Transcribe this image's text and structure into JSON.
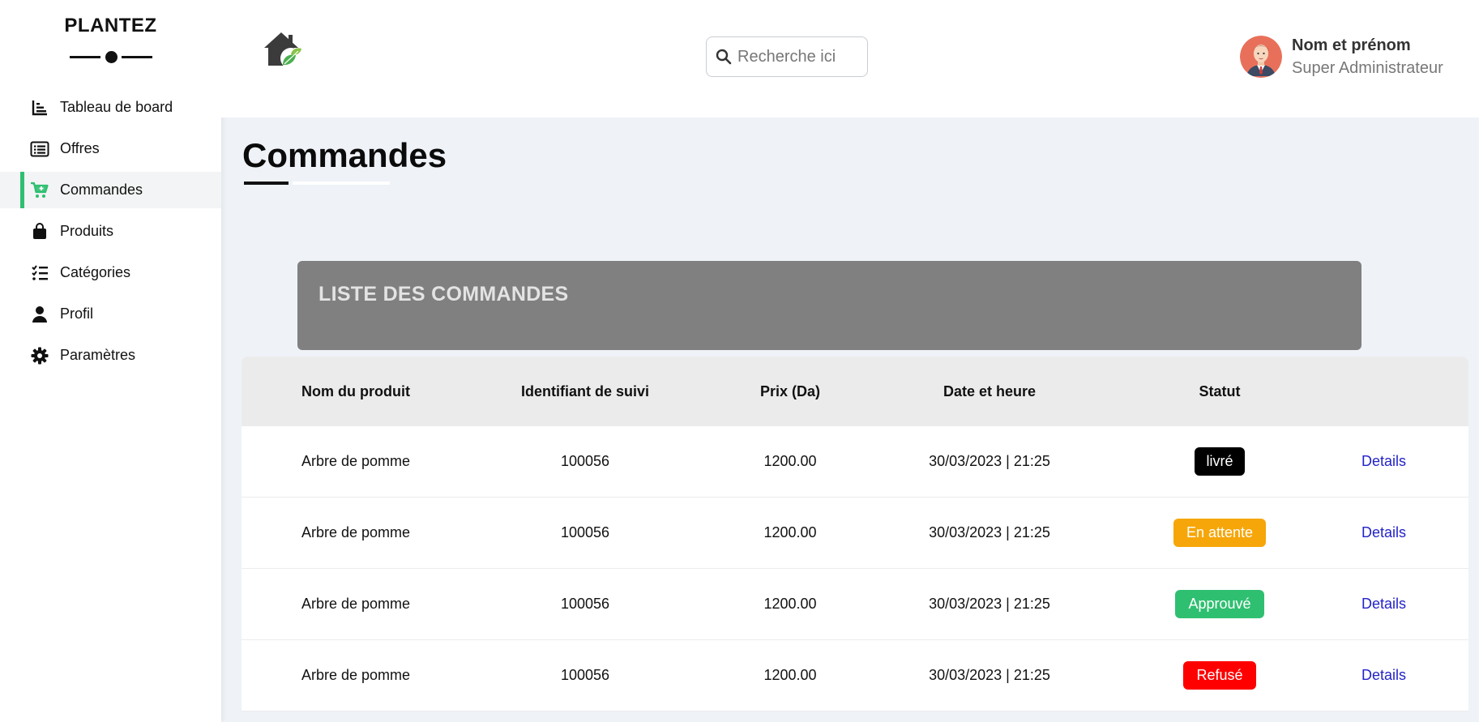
{
  "sidebar": {
    "brand": "PLANTEZ",
    "items": [
      {
        "label": "Tableau de board",
        "icon": "chart-icon"
      },
      {
        "label": "Offres",
        "icon": "list-icon"
      },
      {
        "label": "Commandes",
        "icon": "cart-plus-icon",
        "active": true
      },
      {
        "label": "Produits",
        "icon": "shopping-bag-icon"
      },
      {
        "label": "Catégories",
        "icon": "checklist-icon"
      },
      {
        "label": "Profil",
        "icon": "user-icon"
      },
      {
        "label": "Paramètres",
        "icon": "gear-icon"
      }
    ]
  },
  "header": {
    "search_placeholder": "Recherche ici",
    "user_name": "Nom et prénom",
    "user_role": "Super Administrateur"
  },
  "main": {
    "title": "Commandes",
    "list_title": "LISTE DES COMMANDES",
    "columns": [
      "Nom du produit",
      "Identifiant de suivi",
      "Prix (Da)",
      "Date et heure",
      "Statut"
    ],
    "rows": [
      {
        "product": "Arbre de pomme",
        "tracking": "100056",
        "price": "1200.00",
        "datetime": "30/03/2023 | 21:25",
        "status": "livré",
        "status_color": "#000000",
        "action": "Details"
      },
      {
        "product": "Arbre de pomme",
        "tracking": "100056",
        "price": "1200.00",
        "datetime": "30/03/2023 | 21:25",
        "status": "En attente",
        "status_color": "#f6a609",
        "action": "Details"
      },
      {
        "product": "Arbre de pomme",
        "tracking": "100056",
        "price": "1200.00",
        "datetime": "30/03/2023 | 21:25",
        "status": "Approuvé",
        "status_color": "#2fbf71",
        "action": "Details"
      },
      {
        "product": "Arbre de pomme",
        "tracking": "100056",
        "price": "1200.00",
        "datetime": "30/03/2023 | 21:25",
        "status": "Refusé",
        "status_color": "#ff0000",
        "action": "Details"
      }
    ]
  },
  "colors": {
    "accent": "#2fbf71",
    "background": "#eff2f7",
    "list_header": "#808080",
    "link": "#2323c8"
  }
}
